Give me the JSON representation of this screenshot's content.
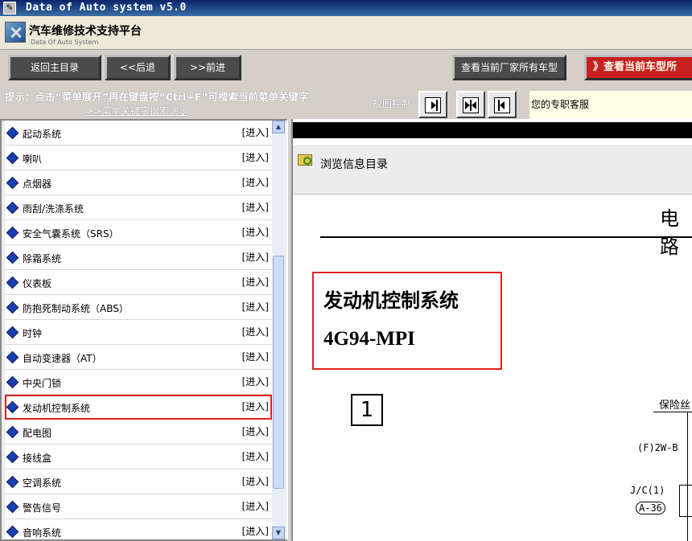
{
  "window": {
    "title": "Data of Auto system v5.0"
  },
  "header": {
    "title_cn": "汽车维修技术支持平台",
    "title_en": "Data Of Auto System"
  },
  "toolbar": {
    "home_label": "返回主目录",
    "back_label": "<<后退",
    "forward_label": ">>前进",
    "maker_models_label": "查看当前厂家所有车型",
    "current_model_label": "》查看当前车型所"
  },
  "hint": {
    "text": "提示：点击“菜单展开”再在键盘按“Ctrl+F”可搜索当前菜单关键字",
    "link": ">>菜单关键字搜索演示",
    "view_control_label": "视图控制",
    "service_text": "您的专职客服"
  },
  "menu": {
    "enter_label": "[进入]",
    "selected_index": 11,
    "items": [
      {
        "label": "起动系统"
      },
      {
        "label": "喇叭"
      },
      {
        "label": "点烟器"
      },
      {
        "label": "雨刮/洗涤系统"
      },
      {
        "label": "安全气囊系统（SRS）"
      },
      {
        "label": "除霜系统"
      },
      {
        "label": "仪表板"
      },
      {
        "label": "防抱死制动系统（ABS）"
      },
      {
        "label": "时钟"
      },
      {
        "label": "自动变速器（AT）"
      },
      {
        "label": "中央门锁"
      },
      {
        "label": "发动机控制系统"
      },
      {
        "label": "配电图"
      },
      {
        "label": "接线盒"
      },
      {
        "label": "空调系统"
      },
      {
        "label": "警告信号"
      },
      {
        "label": "音响系统"
      }
    ]
  },
  "content": {
    "browse_label": "浏览信息目录",
    "doc_title": "电路",
    "system_name": "发动机控制系统",
    "engine_model": "4G94-MPI",
    "section_number": "1",
    "fuse_label": "保险丝",
    "f2w_label": "(F)2W-B",
    "jc_label": "J/C(1)",
    "a36_label": "A-36"
  },
  "colors": {
    "selection_outline": "#e02020",
    "titlebar": "#0a246a",
    "bullet": "#1a3fb0"
  }
}
